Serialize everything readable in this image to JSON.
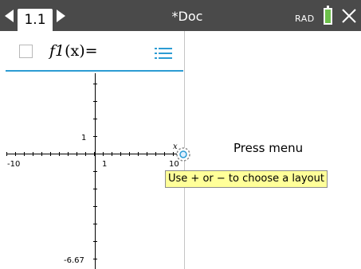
{
  "header": {
    "tab_label": "1.1",
    "doc_title": "*Doc",
    "angle_mode": "RAD"
  },
  "entry_line": {
    "func_name": "f1",
    "func_arg": "(x)",
    "equals": "=",
    "checked": false
  },
  "graph": {
    "xmin_label": "-10",
    "xmax_label": "10",
    "xtick_label": "1",
    "ytick_label": "1",
    "ymin_label": "-6.67",
    "axis_x_marker": "x"
  },
  "right_pane": {
    "message": "Press menu",
    "tooltip": "Use + or − to choose a layout"
  },
  "colors": {
    "topbar": "#4a4a4a",
    "accent": "#2c9cd3",
    "battery": "#6cc04a",
    "tooltip_bg": "#ffff99"
  },
  "icons": [
    "left-arrow-icon",
    "right-arrow-icon",
    "battery-icon",
    "close-icon",
    "checkbox-icon",
    "list-icon",
    "layout-handle-icon"
  ]
}
